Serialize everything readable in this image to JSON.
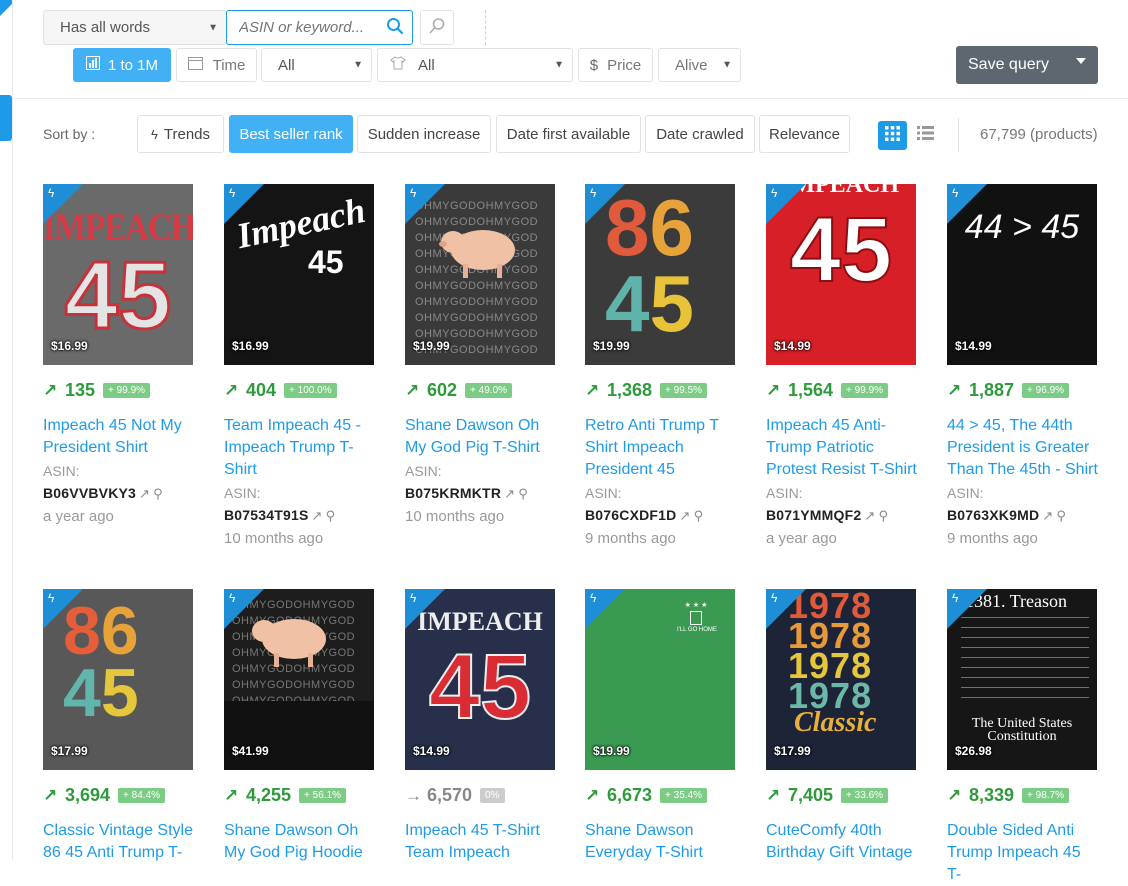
{
  "search": {
    "match_mode": "Has all words",
    "placeholder": "ASIN or keyword...",
    "search_icon": "search-icon",
    "secondary_icon": "magnifier-icon"
  },
  "filters": {
    "rank_range": "1 to 1M",
    "time": "Time",
    "marketplace": "All",
    "category": "All",
    "price": "Price",
    "status": "Alive"
  },
  "save_query": "Save query",
  "sort": {
    "label": "Sort by :",
    "options": [
      "Trends",
      "Best seller rank",
      "Sudden increase",
      "Date first available",
      "Date crawled",
      "Relevance"
    ],
    "active": "Best seller rank"
  },
  "result_count": "67,799 (products)",
  "colors": {
    "accent": "#1e9be8",
    "green": "#2e9a3c"
  },
  "products": [
    {
      "price": "$16.99",
      "arrow": "↗",
      "rank": "135",
      "pct": "+ 99.9%",
      "title": [
        "Impeach 45 Not My",
        "President Shirt"
      ],
      "asin_label": "ASIN:",
      "asin": "B06VVBVKY3",
      "ago": "a year ago"
    },
    {
      "price": "$16.99",
      "arrow": "↗",
      "rank": "404",
      "pct": "+ 100.0%",
      "title": [
        "Team Impeach 45 -",
        "Impeach Trump T-",
        "Shirt"
      ],
      "asin_label": "ASIN:",
      "asin": "B07534T91S",
      "ago": "10 months ago"
    },
    {
      "price": "$19.99",
      "arrow": "↗",
      "rank": "602",
      "pct": "+ 49.0%",
      "title": [
        "Shane Dawson Oh",
        "My God Pig T-Shirt"
      ],
      "asin_label": "ASIN:",
      "asin": "B075KRMKTR",
      "ago": "10 months ago"
    },
    {
      "price": "$19.99",
      "arrow": "↗",
      "rank": "1,368",
      "pct": "+ 99.5%",
      "title": [
        "Retro Anti Trump T",
        "Shirt Impeach",
        "President 45"
      ],
      "asin_label": "ASIN:",
      "asin": "B076CXDF1D",
      "ago": "9 months ago"
    },
    {
      "price": "$14.99",
      "arrow": "↗",
      "rank": "1,564",
      "pct": "+ 99.9%",
      "title": [
        "Impeach 45 Anti-",
        "Trump Patriotic",
        "Protest Resist T-Shirt"
      ],
      "asin_label": "ASIN:",
      "asin": "B071YMMQF2",
      "ago": "a year ago"
    },
    {
      "price": "$14.99",
      "arrow": "↗",
      "rank": "1,887",
      "pct": "+ 96.9%",
      "title": [
        "44 > 45, The 44th",
        "President is Greater",
        "Than The 45th - Shirt"
      ],
      "asin_label": "ASIN:",
      "asin": "B0763XK9MD",
      "ago": "9 months ago"
    },
    {
      "price": "$17.99",
      "arrow": "↗",
      "rank": "3,694",
      "pct": "+ 84.4%",
      "title": [
        "Classic Vintage Style",
        "86 45 Anti Trump T-"
      ],
      "asin_label": "",
      "asin": "",
      "ago": ""
    },
    {
      "price": "$41.99",
      "arrow": "↗",
      "rank": "4,255",
      "pct": "+ 56.1%",
      "title": [
        "Shane Dawson Oh",
        "My God Pig Hoodie"
      ],
      "asin_label": "",
      "asin": "",
      "ago": ""
    },
    {
      "price": "$14.99",
      "arrow": "→",
      "rank": "6,570",
      "pct": "0%",
      "title": [
        "Impeach 45 T-Shirt",
        "Team Impeach"
      ],
      "asin_label": "",
      "asin": "",
      "ago": ""
    },
    {
      "price": "$19.99",
      "arrow": "↗",
      "rank": "6,673",
      "pct": "+ 35.4%",
      "title": [
        "Shane Dawson",
        "Everyday T-Shirt"
      ],
      "asin_label": "",
      "asin": "",
      "ago": ""
    },
    {
      "price": "$17.99",
      "arrow": "↗",
      "rank": "7,405",
      "pct": "+ 33.6%",
      "title": [
        "CuteComfy 40th",
        "Birthday Gift Vintage"
      ],
      "asin_label": "",
      "asin": "",
      "ago": ""
    },
    {
      "price": "$26.98",
      "arrow": "↗",
      "rank": "8,339",
      "pct": "+ 98.7%",
      "title": [
        "Double Sided Anti",
        "Trump Impeach 45 T-"
      ],
      "asin_label": "",
      "asin": "",
      "ago": ""
    }
  ],
  "art": {
    "impeach": "IMPEACH",
    "impeach_script": "Impeach",
    "n45": "45",
    "n86": "86",
    "gt": "44 > 45",
    "oh": "OHMYGODOHMYGOD",
    "gohome": "I'LL GO HOME",
    "year": "1978",
    "classic": "Classic",
    "treason": "1381. Treason",
    "us": "The United States",
    "constitution": "Constitution"
  }
}
